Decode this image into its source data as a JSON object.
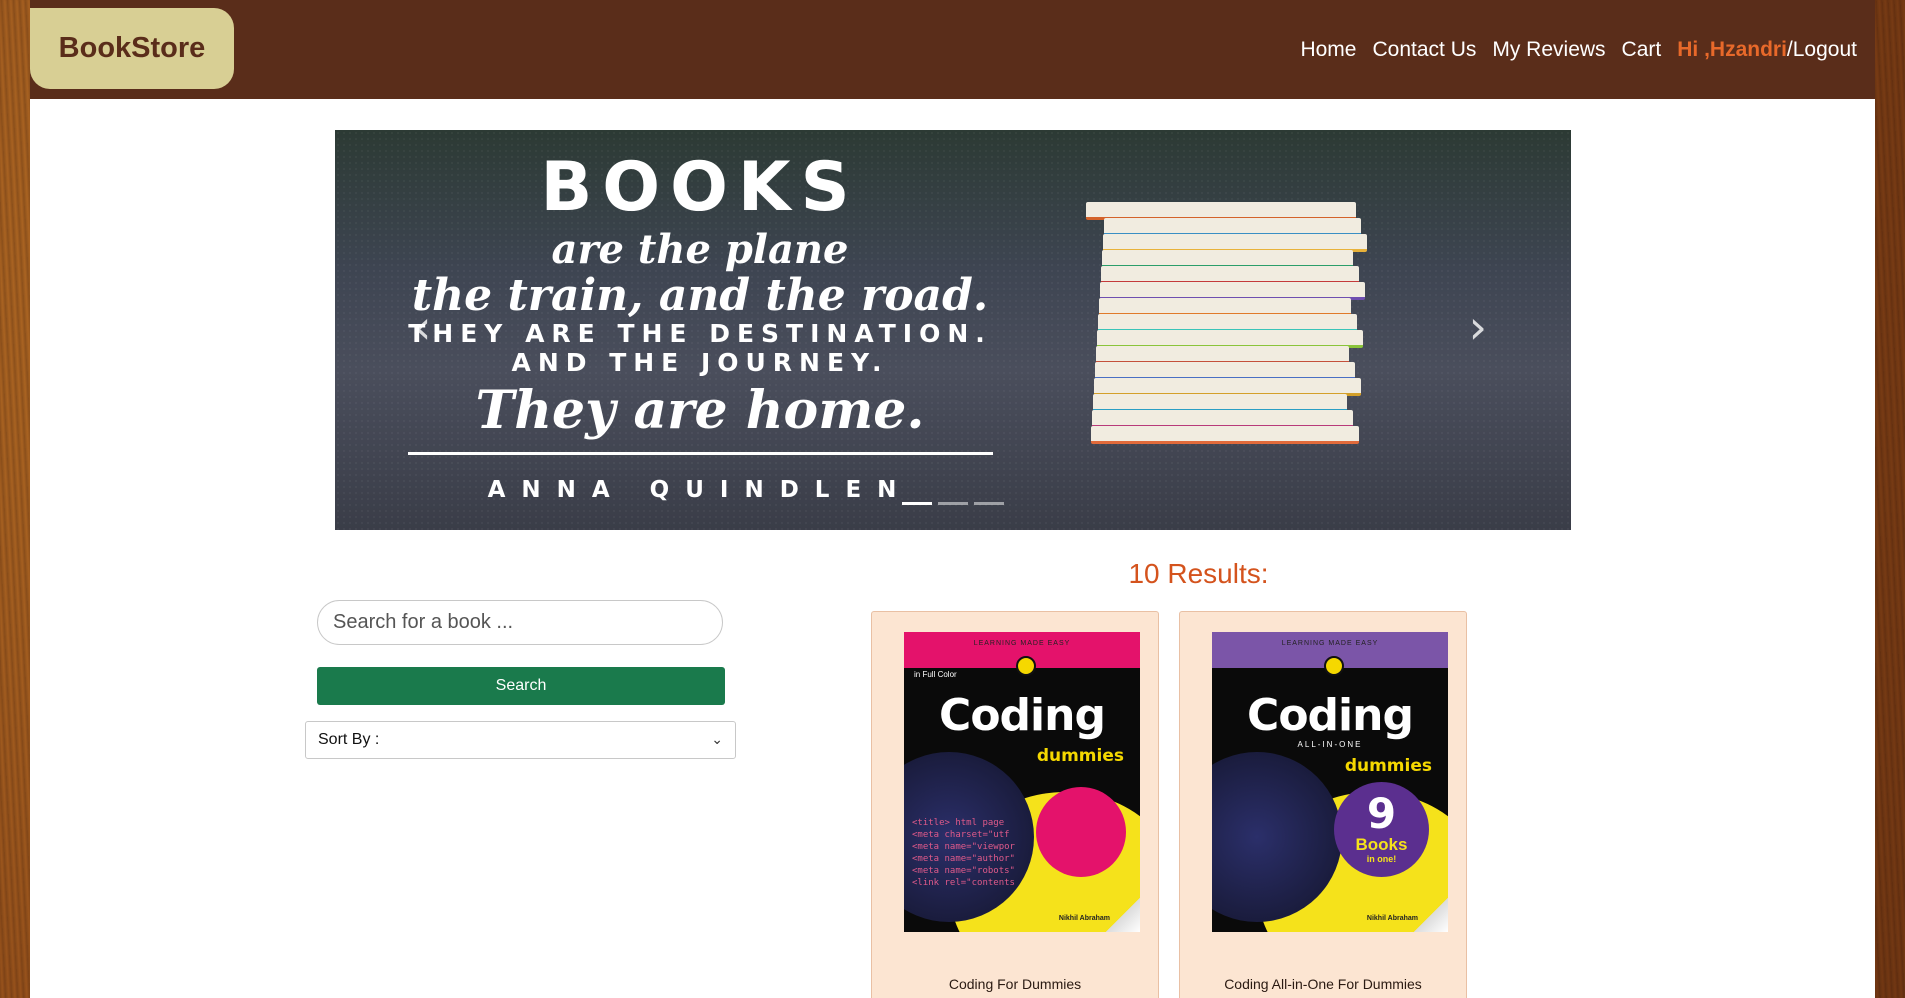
{
  "navbar": {
    "brand": "BookStore",
    "links": [
      "Home",
      "Contact Us",
      "My Reviews",
      "Cart"
    ],
    "greeting": "Hi ,",
    "user_name": "Hzandri",
    "logout": "/Logout",
    "colors": {
      "bar": "#5a2d1a",
      "brand_bg": "#d8cf94",
      "accent": "#e8692a"
    }
  },
  "carousel": {
    "quote_lines": [
      "BOOKS",
      "are the plane",
      "the train, and the road.",
      "THEY ARE THE DESTINATION.",
      "AND THE JOURNEY.",
      "They are home."
    ],
    "author": "ANNA QUINDLEN",
    "prev_icon": "‹",
    "next_icon": "›",
    "indicators": 3,
    "active_indicator": 0
  },
  "search": {
    "placeholder": "Search for a book ...",
    "button_label": "Search",
    "sort_label": "Sort By :"
  },
  "results": {
    "title": "10 Results:",
    "books": [
      {
        "title": "Coding For Dummies",
        "cover": {
          "band_text": "LEARNING MADE EASY",
          "tag": "in Full Color",
          "title": "Coding",
          "subtitle": "",
          "brand": "dummies",
          "author": "Nikhil Abraham",
          "band_color": "#e4126b"
        }
      },
      {
        "title": "Coding All-in-One For Dummies",
        "cover": {
          "band_text": "LEARNING MADE EASY",
          "tag": "",
          "title": "Coding",
          "subtitle": "ALL-IN-ONE",
          "brand": "dummies",
          "badge_number": "9",
          "badge_books": "Books",
          "badge_inone": "in one!",
          "author": "Nikhil Abraham",
          "band_color": "#7b55a8"
        }
      }
    ]
  }
}
